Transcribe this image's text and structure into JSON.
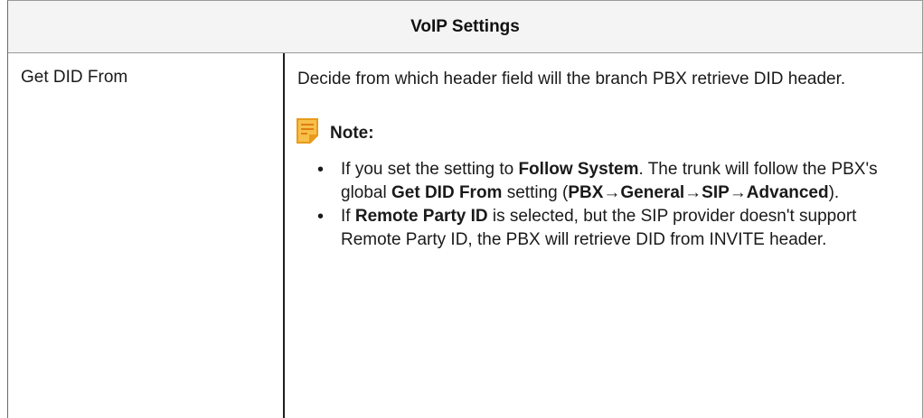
{
  "table": {
    "header": "VoIP Settings",
    "row": {
      "name": "Get DID From",
      "description": "Decide from which header field will the branch PBX retrieve DID header."
    }
  },
  "note": {
    "icon": "note-icon",
    "title": "Note:",
    "bullet1": {
      "t1": "If you set the setting to ",
      "b1": "Follow System",
      "t2": ". The trunk will follow the PBX's global ",
      "b2": "Get DID From",
      "t3": " setting (",
      "b3": "PBX",
      "a1": "→",
      "b4": "General",
      "a2": "→",
      "b5": "SIP",
      "a3": "→",
      "b6": "Advanced",
      "t4": ")."
    },
    "bullet2": {
      "t1": "If ",
      "b1": "Remote Party ID",
      "t2": " is selected, but the SIP provider doesn't support Remote Party ID, the PBX will retrieve DID from INVITE header."
    }
  },
  "colors": {
    "header_bg": "#f4f4f4",
    "note_icon": "#f2a92c",
    "border": "#9a9a9a"
  }
}
